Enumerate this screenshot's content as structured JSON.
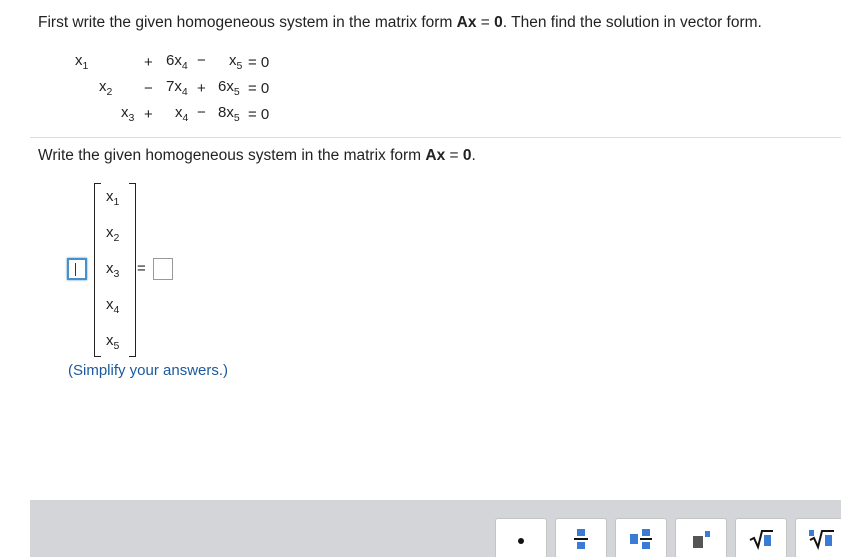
{
  "prompt": {
    "part1": "First write the given homogeneous system in the matrix form ",
    "ax": "Ax",
    "eq": " = ",
    "zero": "0",
    "part2": ". Then find the solution in vector form."
  },
  "system": {
    "row1": {
      "x": "x",
      "x_sub": "1",
      "op1": "+",
      "c1": "6x",
      "s1": "4",
      "op2": "−",
      "c2": "x",
      "s2": "5",
      "rhs": "= 0"
    },
    "row2": {
      "x": "x",
      "x_sub": "2",
      "op1": "−",
      "c1": "7x",
      "s1": "4",
      "op2": "+",
      "c2": "6x",
      "s2": "5",
      "rhs": "= 0"
    },
    "row3": {
      "x": "x",
      "x_sub": "3",
      "op1": "+",
      "c1": "x",
      "s1": "4",
      "op2": "−",
      "c2": "8x",
      "s2": "5",
      "rhs": "= 0"
    }
  },
  "instruction": {
    "text": "Write the given homogeneous system in the matrix form ",
    "ax": "Ax",
    "eq": " = ",
    "zero": "0",
    "end": "."
  },
  "vector": [
    {
      "var": "x",
      "sub": "1"
    },
    {
      "var": "x",
      "sub": "2"
    },
    {
      "var": "x",
      "sub": "3"
    },
    {
      "var": "x",
      "sub": "4"
    },
    {
      "var": "x",
      "sub": "5"
    }
  ],
  "equals": "=",
  "answer_matrix_value": "",
  "answer_rhs_value": "",
  "hint": "(Simplify your answers.)",
  "toolbar": {
    "buttons": [
      "dot-icon",
      "fraction-icon",
      "mixed-number-icon",
      "exponent-icon",
      "square-root-icon",
      "nth-root-icon"
    ]
  }
}
